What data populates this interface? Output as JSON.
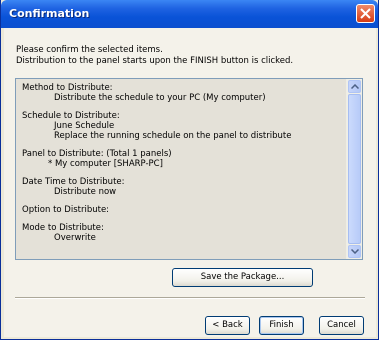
{
  "window": {
    "title": "Confirmation"
  },
  "intro": {
    "line1": "Please confirm the selected items.",
    "line2": "Distribution to the panel starts upon the FINISH button is clicked."
  },
  "details": {
    "method": {
      "label": "Method to Distribute:",
      "value": "Distribute the schedule to your PC (My computer)"
    },
    "schedule": {
      "label": "Schedule to Distribute:",
      "value": "June Schedule",
      "note": "Replace the running schedule on the panel to distribute"
    },
    "panel": {
      "label": "Panel to Distribute:  (Total 1 panels)",
      "value": "* My computer [SHARP-PC]"
    },
    "datetime": {
      "label": "Date Time to Distribute:",
      "value": "Distribute now"
    },
    "option": {
      "label": "Option to Distribute:"
    },
    "mode": {
      "label": "Mode to Distribute:",
      "value": "Overwrite"
    }
  },
  "buttons": {
    "save_package": "Save the Package...",
    "back": "< Back",
    "finish": "Finish",
    "cancel": "Cancel"
  },
  "icons": {
    "close": "close-icon",
    "scroll_up": "scroll-up-arrow-icon",
    "scroll_down": "scroll-down-arrow-icon"
  },
  "colors": {
    "titlebar": "#0a53d8",
    "close_button": "#d63c16",
    "dialog_bg": "#f4f2ea"
  }
}
